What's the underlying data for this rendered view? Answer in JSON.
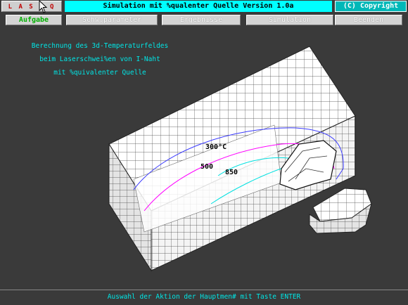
{
  "header": {
    "logo": "L A S E Q",
    "title": "Simulation mit %qualenter Quelle    Version 1.0a",
    "copyright": "(C) Copyright"
  },
  "menu": [
    {
      "label": "Aufgabe",
      "state": "active"
    },
    {
      "label": "Schw.parameter",
      "state": "normal"
    },
    {
      "label": "Ergebnisse",
      "state": "normal"
    },
    {
      "label": "Simulation",
      "state": "normal"
    },
    {
      "label": "Beenden",
      "state": "normal"
    }
  ],
  "description": {
    "line1": "Berechnung des 3d-Temperaturfeldes",
    "line2": "beim Laserschwei%en von I-Naht",
    "line3": "mit %quivalenter Quelle"
  },
  "isotherms": {
    "t300": "300°C",
    "t500": "500",
    "t850": "850"
  },
  "status": "Auswahl der Aktion der Hauptmen# mit Taste ENTER",
  "colors": {
    "background": "#3a3a3a",
    "accent_cyan": "#00ffff",
    "menu_active": "#00b000",
    "isotherm_300": "#3a3aff",
    "isotherm_500": "#ff00ff",
    "isotherm_850": "#00e0e0"
  }
}
